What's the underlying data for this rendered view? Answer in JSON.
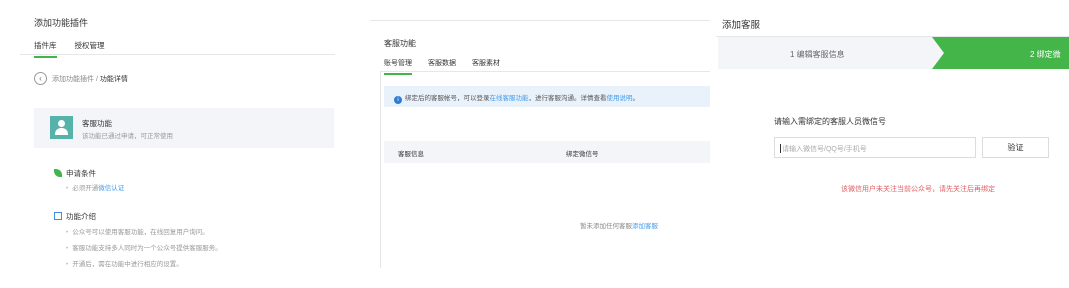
{
  "panel1": {
    "title": "添加功能插件",
    "tabs": [
      "插件库",
      "授权管理"
    ],
    "breadcrumb_parent": "添加功能插件 / ",
    "breadcrumb_current": "功能详情",
    "back_icon": "‹",
    "plugin": {
      "name": "客服功能",
      "desc": "该功能已通过申请，可正常使用"
    },
    "conditions": {
      "heading": "申请条件",
      "item_prefix": "必须开通",
      "item_link": "微信认证"
    },
    "intro": {
      "heading": "功能介绍",
      "items": [
        "公众号可以使用客服功能，在线回复用户询问。",
        "客服功能支持多人同时为一个公众号提供客服服务。",
        "开通后，需在功能中进行相应的设置。"
      ]
    },
    "colors": {
      "accent": "#44b549",
      "link": "#459ae9",
      "card_icon": "#56b3aa"
    },
    "icons": [
      "chevron-left-icon",
      "user-avatar-icon",
      "leaf-icon",
      "info-box-icon"
    ]
  },
  "panel2": {
    "title": "客服功能",
    "tabs": [
      "账号管理",
      "客服数据",
      "客服素材"
    ],
    "info": {
      "icon": "i",
      "part1": "绑定后的客服帐号，可以登录",
      "link1": "在线客服功能",
      "part2": "，进行客服沟通。详情查看",
      "link2": "使用说明",
      "part3": "。"
    },
    "table": {
      "headers": [
        "客服信息",
        "绑定微信号"
      ],
      "empty_text": "暂未添加任何客服",
      "empty_link": "添加客服"
    }
  },
  "panel3": {
    "title": "添加客服",
    "steps": [
      "1 编辑客服信息",
      "2 绑定微"
    ],
    "input_label": "请输入需绑定的客服人员微信号",
    "input_placeholder": "请输入微信号/QQ号/手机号",
    "verify_button": "验证",
    "warning": "该微信用户未关注当前公众号，请先关注后再绑定",
    "colors": {
      "step_active": "#44b549",
      "warning": "#e15f63"
    }
  }
}
